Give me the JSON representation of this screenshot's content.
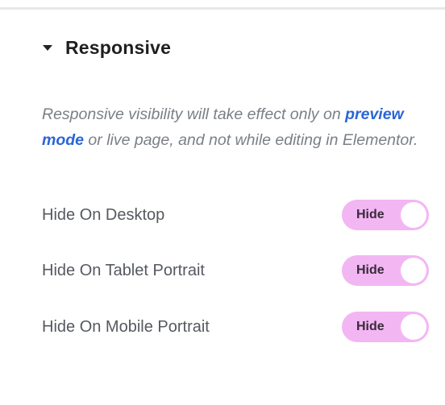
{
  "section": {
    "title": "Responsive"
  },
  "description": {
    "before": "Responsive visibility will take effect only on ",
    "link": "preview mode",
    "after": " or live page, and not while editing in Elementor."
  },
  "rows": [
    {
      "label": "Hide On Desktop",
      "toggle_label": "Hide"
    },
    {
      "label": "Hide On Tablet Portrait",
      "toggle_label": "Hide"
    },
    {
      "label": "Hide On Mobile Portrait",
      "toggle_label": "Hide"
    }
  ],
  "colors": {
    "toggle_bg": "#f2b6f3",
    "link": "#2a66d4"
  },
  "icons": {
    "section_toggle": "caret-down-icon"
  }
}
